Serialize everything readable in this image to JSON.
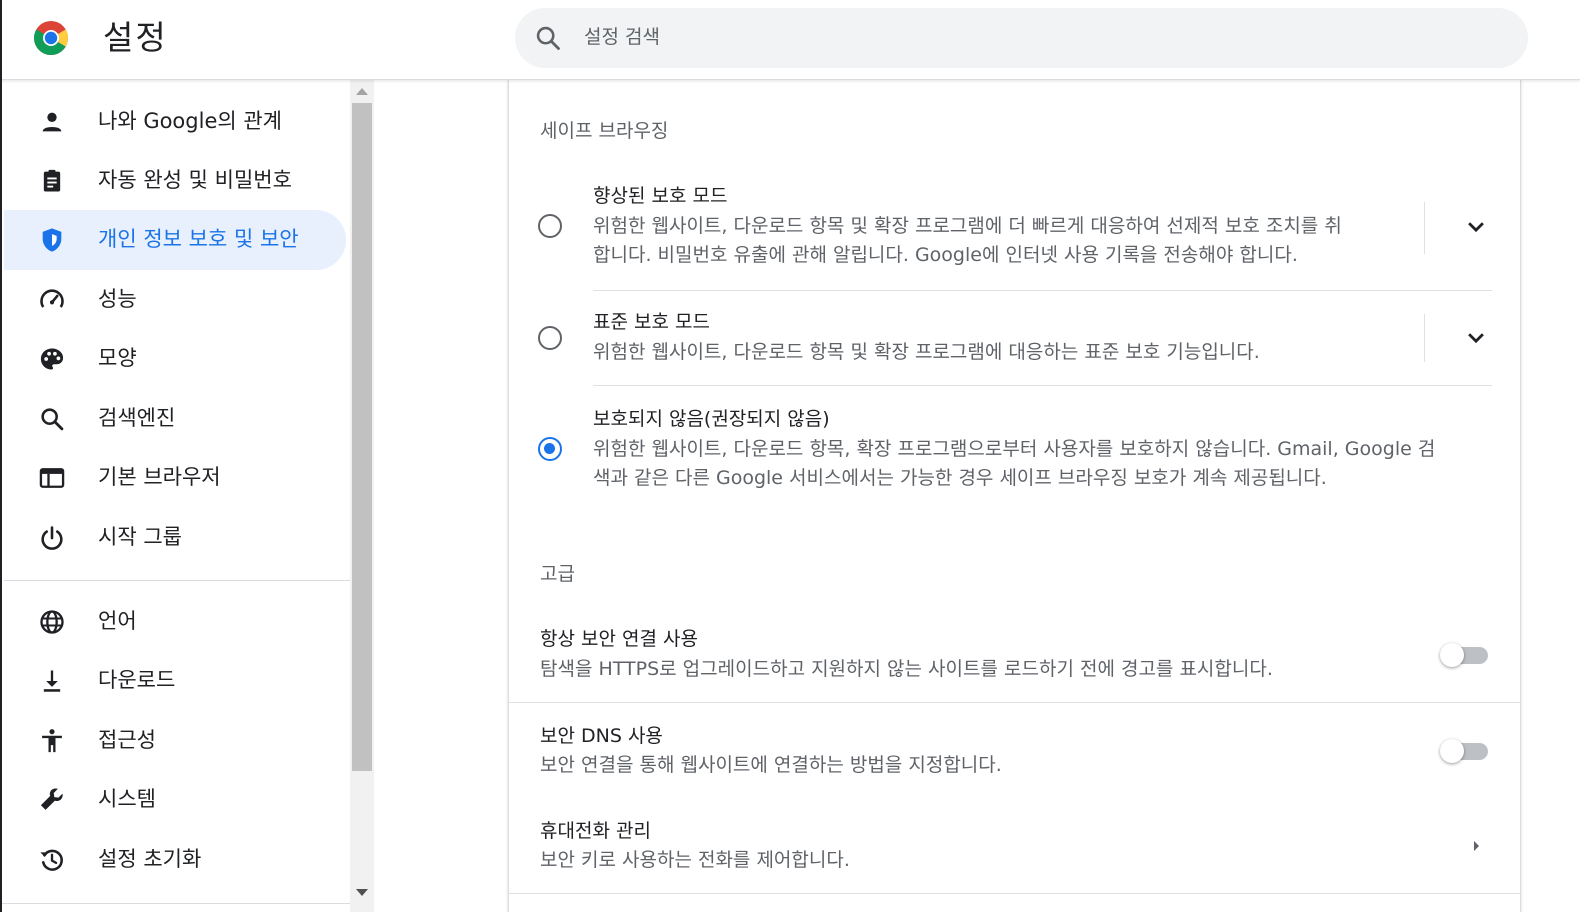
{
  "header": {
    "title": "설정",
    "search": {
      "placeholder": "설정 검색",
      "value": ""
    }
  },
  "sidebar": {
    "items": [
      {
        "label": "나와 Google의 관계",
        "icon": "person-icon"
      },
      {
        "label": "자동 완성 및 비밀번호",
        "icon": "clipboard-icon"
      },
      {
        "label": "개인 정보 보호 및 보안",
        "icon": "shield-icon",
        "active": true
      },
      {
        "label": "성능",
        "icon": "speedometer-icon"
      },
      {
        "label": "모양",
        "icon": "palette-icon"
      },
      {
        "label": "검색엔진",
        "icon": "search-icon"
      },
      {
        "label": "기본 브라우저",
        "icon": "browser-icon"
      },
      {
        "label": "시작 그룹",
        "icon": "power-icon"
      },
      {
        "label": "언어",
        "icon": "globe-icon"
      },
      {
        "label": "다운로드",
        "icon": "download-icon"
      },
      {
        "label": "접근성",
        "icon": "accessibility-icon"
      },
      {
        "label": "시스템",
        "icon": "wrench-icon"
      },
      {
        "label": "설정 초기화",
        "icon": "restore-icon"
      }
    ]
  },
  "main": {
    "safe_browsing": {
      "heading": "세이프 브라우징",
      "options": [
        {
          "title": "향상된 보호 모드",
          "desc_line1": "위험한 웹사이트, 다운로드 항목 및 확장 프로그램에 더 빠르게 대응하여 선제적 보호 조치를 취",
          "desc_line2": "합니다. 비밀번호 유출에 관해 알립니다. Google에 인터넷 사용 기록을 전송해야 합니다.",
          "selected": false
        },
        {
          "title": "표준 보호 모드",
          "desc_line1": "위험한 웹사이트, 다운로드 항목 및 확장 프로그램에 대응하는 표준 보호 기능입니다.",
          "selected": false
        },
        {
          "title": "보호되지 않음(권장되지 않음)",
          "desc_line1": "위험한 웹사이트, 다운로드 항목, 확장 프로그램으로부터 사용자를 보호하지 않습니다. Gmail, Google 검",
          "desc_line2": "색과 같은 다른 Google 서비스에서는 가능한 경우 세이프 브라우징 보호가 계속 제공됩니다.",
          "selected": true
        }
      ]
    },
    "advanced": {
      "heading": "고급",
      "https_first": {
        "title": "항상 보안 연결 사용",
        "desc": "탐색을 HTTPS로 업그레이드하고 지원하지 않는 사이트를 로드하기 전에 경고를 표시합니다.",
        "enabled": false
      },
      "secure_dns": {
        "title": "보안 DNS 사용",
        "desc": "보안 연결을 통해 웹사이트에 연결하는 방법을 지정합니다.",
        "enabled": false
      },
      "manage_phones": {
        "title": "휴대전화 관리",
        "desc": "보안 키로 사용하는 전화를 제어합니다."
      }
    }
  },
  "colors": {
    "accent": "#1a73e8",
    "active_bg": "#e8f0fe",
    "text_primary": "#202124",
    "text_secondary": "#5f6368"
  }
}
